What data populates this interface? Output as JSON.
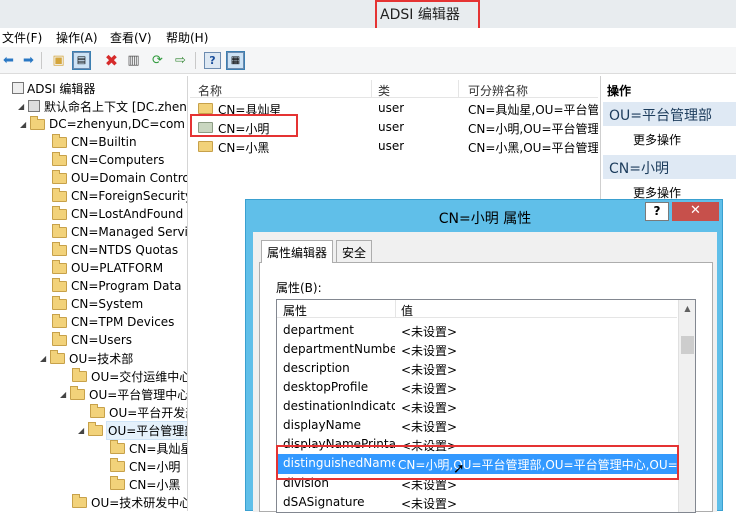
{
  "window": {
    "title": "ADSI 编辑器"
  },
  "menu": [
    "文件(F)",
    "操作(A)",
    "查看(V)",
    "帮助(H)"
  ],
  "toolbar": {
    "icons": [
      "back-arrow-icon",
      "forward-arrow-icon",
      "up-folder-icon",
      "show-hide-tree-icon",
      "delete-icon",
      "properties-icon",
      "refresh-icon",
      "export-list-icon",
      "help-icon",
      "action-pane-icon"
    ]
  },
  "tree": {
    "items": [
      {
        "label": "ADSI 编辑器",
        "level": 0,
        "arrow": ""
      },
      {
        "label": "默认命名上下文 [DC.zhenyun.com]",
        "level": 1,
        "arrow": "◢"
      },
      {
        "label": "DC=zhenyun,DC=com",
        "level": 2,
        "arrow": "◢"
      },
      {
        "label": "CN=Builtin",
        "level": 3,
        "arrow": ""
      },
      {
        "label": "CN=Computers",
        "level": 3,
        "arrow": ""
      },
      {
        "label": "OU=Domain Controllers",
        "level": 3,
        "arrow": ""
      },
      {
        "label": "CN=ForeignSecurityPrincipals",
        "level": 3,
        "arrow": ""
      },
      {
        "label": "CN=LostAndFound",
        "level": 3,
        "arrow": ""
      },
      {
        "label": "CN=Managed Service Accounts",
        "level": 3,
        "arrow": ""
      },
      {
        "label": "CN=NTDS Quotas",
        "level": 3,
        "arrow": ""
      },
      {
        "label": "OU=PLATFORM",
        "level": 3,
        "arrow": ""
      },
      {
        "label": "CN=Program Data",
        "level": 3,
        "arrow": ""
      },
      {
        "label": "CN=System",
        "level": 3,
        "arrow": ""
      },
      {
        "label": "CN=TPM Devices",
        "level": 3,
        "arrow": ""
      },
      {
        "label": "CN=Users",
        "level": 3,
        "arrow": ""
      },
      {
        "label": "OU=技术部",
        "level": 3,
        "arrow": "◢"
      },
      {
        "label": "OU=交付运维中心",
        "level": 4,
        "arrow": ""
      },
      {
        "label": "OU=平台管理中心",
        "level": 4,
        "arrow": "◢"
      },
      {
        "label": "OU=平台开发部",
        "level": 5,
        "arrow": ""
      },
      {
        "label": "OU=平台管理部",
        "level": 5,
        "arrow": "◢",
        "selected": true
      },
      {
        "label": "CN=具灿星",
        "level": 6,
        "arrow": ""
      },
      {
        "label": "CN=小明",
        "level": 6,
        "arrow": ""
      },
      {
        "label": "CN=小黑",
        "level": 6,
        "arrow": ""
      },
      {
        "label": "OU=技术研发中心",
        "level": 4,
        "arrow": ""
      }
    ]
  },
  "list": {
    "columns": [
      "名称",
      "类",
      "可分辨名称"
    ],
    "rows": [
      {
        "name": "CN=具灿星",
        "class": "user",
        "dn": "CN=具灿星,OU=平台管理部"
      },
      {
        "name": "CN=小明",
        "class": "user",
        "dn": "CN=小明,OU=平台管理部"
      },
      {
        "name": "CN=小黑",
        "class": "user",
        "dn": "CN=小黑,OU=平台管理部"
      }
    ]
  },
  "actions": {
    "title": "操作",
    "sections": [
      {
        "header": "OU=平台管理部",
        "item": "更多操作"
      },
      {
        "header": "CN=小明",
        "item": "更多操作"
      }
    ]
  },
  "dialog": {
    "title": "CN=小明 属性",
    "help": "?",
    "close": "✕",
    "tabs": [
      "属性编辑器",
      "安全"
    ],
    "attributes_label": "属性(B):",
    "columns": [
      "属性",
      "值"
    ],
    "rows": [
      {
        "attr": "department",
        "value": "<未设置>"
      },
      {
        "attr": "departmentNumber",
        "value": "<未设置>"
      },
      {
        "attr": "description",
        "value": "<未设置>"
      },
      {
        "attr": "desktopProfile",
        "value": "<未设置>"
      },
      {
        "attr": "destinationIndicator",
        "value": "<未设置>"
      },
      {
        "attr": "displayName",
        "value": "<未设置>"
      },
      {
        "attr": "displayNamePrintable",
        "value": "<未设置>"
      },
      {
        "attr": "distinguishedName",
        "value": "CN=小明,OU=平台管理部,OU=平台管理中心,OU=技术部,DC=zhenyun,DC=com",
        "highlighted": true
      },
      {
        "attr": "division",
        "value": "<未设置>"
      },
      {
        "attr": "dSASignature",
        "value": "<未设置>"
      }
    ]
  },
  "colors": {
    "dialog_frame": "#60bfe9",
    "selection": "#3399ff",
    "annotation_box": "#e53333"
  }
}
